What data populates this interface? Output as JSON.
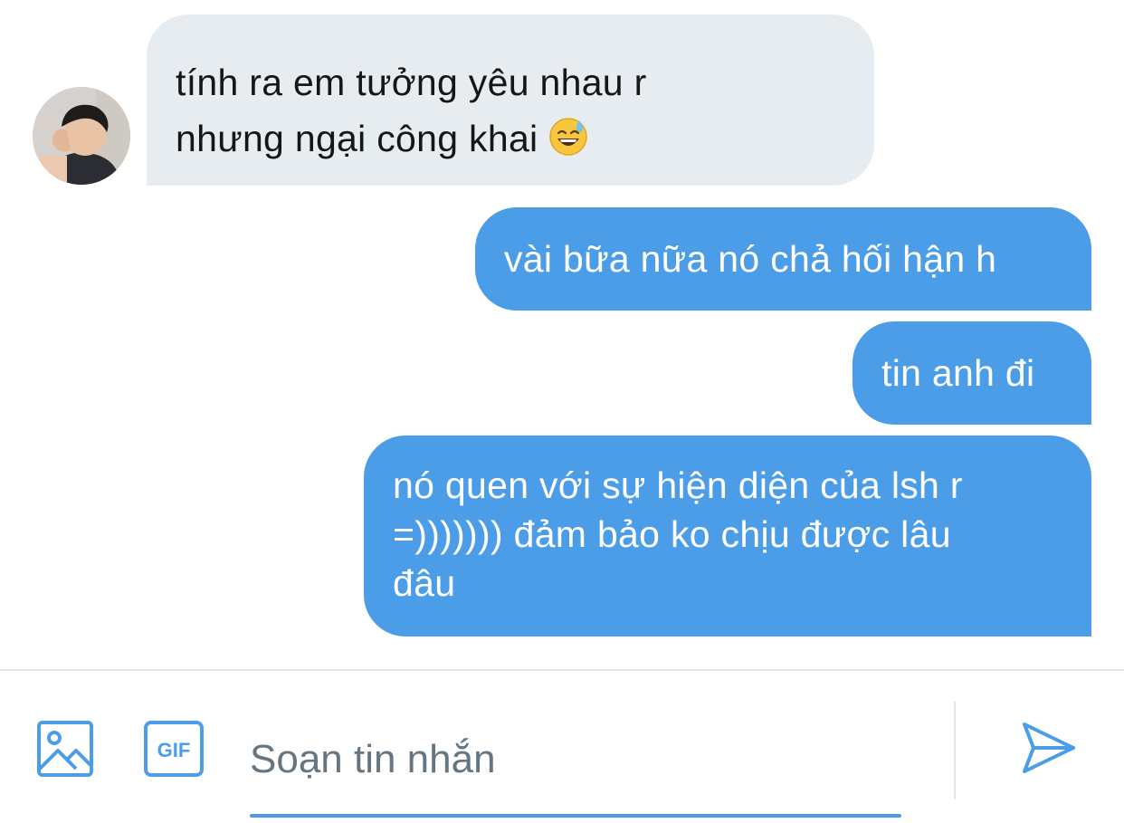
{
  "conversation": {
    "incoming": [
      {
        "lines": [
          "tính ra em tưởng yêu nhau r",
          "nhưng ngại công khai"
        ],
        "emoji": "sweat-smile-emoji"
      }
    ],
    "outgoing": [
      {
        "lines": [
          "vài bữa nữa nó chả hối hận h"
        ]
      },
      {
        "lines": [
          "tin anh đi"
        ]
      },
      {
        "lines": [
          "nó quen với sự hiện diện của lsh r",
          "=))))))) đảm bảo ko chịu được lâu",
          "đâu"
        ]
      }
    ]
  },
  "composer": {
    "placeholder": "Soạn tin nhắn",
    "value": "",
    "gif_label": "GIF",
    "icons": {
      "image": "image-icon",
      "gif": "gif-icon",
      "send": "send-icon"
    }
  },
  "colors": {
    "accent": "#4c9de8",
    "incoming_bubble": "#e6ecf0",
    "incoming_text": "#14171a",
    "outgoing_text": "#ffffff",
    "placeholder": "#66757f"
  }
}
